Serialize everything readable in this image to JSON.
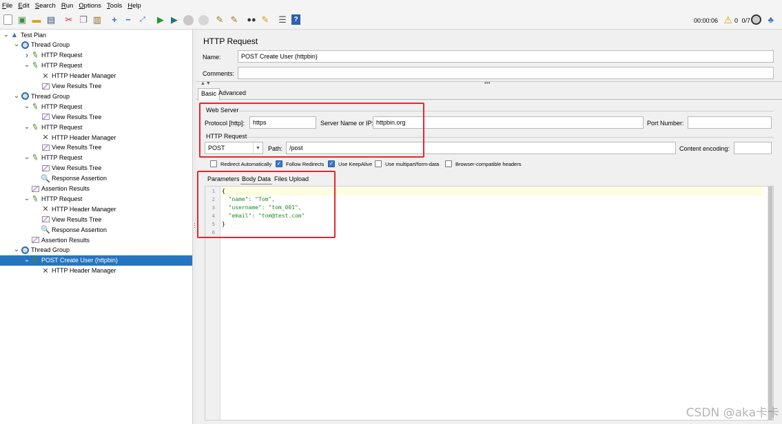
{
  "menubar": {
    "items": [
      "File",
      "Edit",
      "Search",
      "Run",
      "Options",
      "Tools",
      "Help"
    ]
  },
  "toolbar": {
    "icons": [
      "new-icon",
      "templates-icon",
      "open-icon",
      "save-icon",
      "cut-icon",
      "copy-icon",
      "paste-icon",
      "expand-icon",
      "collapse-icon",
      "toggle-icon",
      "start-icon",
      "start-no-pauses-icon",
      "stop-icon",
      "shutdown-icon",
      "clear-icon",
      "clear-all-icon",
      "search-icon",
      "reset-search-icon",
      "function-helper-icon",
      "help-icon"
    ],
    "elapsed_time": "00:00:06",
    "warning_count": "0",
    "thread_count": "0/7",
    "accent_color": "#2675bf"
  },
  "tree": {
    "nodes": [
      {
        "label": "Test Plan",
        "icon": "test-plan-icon",
        "arrow": "v",
        "indent": 0
      },
      {
        "label": "Thread Group",
        "icon": "thread-group-icon",
        "arrow": "v",
        "indent": 1
      },
      {
        "label": "HTTP Request",
        "icon": "sampler-icon",
        "arrow": ">",
        "indent": 2
      },
      {
        "label": "HTTP Request",
        "icon": "sampler-icon",
        "arrow": "v",
        "indent": 2
      },
      {
        "label": "HTTP Header Manager",
        "icon": "header-manager-icon",
        "arrow": "",
        "indent": 3
      },
      {
        "label": "View Results Tree",
        "icon": "listener-icon",
        "arrow": "",
        "indent": 3
      },
      {
        "label": "Thread Group",
        "icon": "thread-group-icon",
        "arrow": "v",
        "indent": 1
      },
      {
        "label": "HTTP Request",
        "icon": "sampler-icon",
        "arrow": "v",
        "indent": 2
      },
      {
        "label": "View Results Tree",
        "icon": "listener-icon",
        "arrow": "",
        "indent": 3
      },
      {
        "label": "HTTP Request",
        "icon": "sampler-icon",
        "arrow": "v",
        "indent": 2
      },
      {
        "label": "HTTP Header Manager",
        "icon": "header-manager-icon",
        "arrow": "",
        "indent": 3
      },
      {
        "label": "View Results Tree",
        "icon": "listener-icon",
        "arrow": "",
        "indent": 3
      },
      {
        "label": "HTTP Request",
        "icon": "sampler-icon",
        "arrow": "v",
        "indent": 2
      },
      {
        "label": "View Results Tree",
        "icon": "listener-icon",
        "arrow": "",
        "indent": 3
      },
      {
        "label": "Response Assertion",
        "icon": "assertion-icon",
        "arrow": "",
        "indent": 3
      },
      {
        "label": "Assertion Results",
        "icon": "listener-icon",
        "arrow": "",
        "indent": 2
      },
      {
        "label": "HTTP Request",
        "icon": "sampler-icon",
        "arrow": "v",
        "indent": 2
      },
      {
        "label": "HTTP Header Manager",
        "icon": "header-manager-icon",
        "arrow": "",
        "indent": 3
      },
      {
        "label": "View Results Tree",
        "icon": "listener-icon",
        "arrow": "",
        "indent": 3
      },
      {
        "label": "Response Assertion",
        "icon": "assertion-icon",
        "arrow": "",
        "indent": 3
      },
      {
        "label": "Assertion Results",
        "icon": "listener-icon",
        "arrow": "",
        "indent": 2
      },
      {
        "label": "Thread Group",
        "icon": "thread-group-icon",
        "arrow": "v",
        "indent": 1
      },
      {
        "label": "POST Create User (httpbin)",
        "icon": "sampler-icon",
        "arrow": "v",
        "indent": 2,
        "selected": true
      },
      {
        "label": "HTTP Header Manager",
        "icon": "header-manager-icon",
        "arrow": "",
        "indent": 3
      }
    ]
  },
  "panel": {
    "title": "HTTP Request",
    "name_label": "Name:",
    "name_value": "POST Create User (httpbin)",
    "comments_label": "Comments:",
    "comments_value": "",
    "tabs": [
      "Basic",
      "Advanced"
    ],
    "web_server": {
      "title": "Web Server",
      "protocol_label": "Protocol [http]:",
      "protocol_value": "https",
      "server_label": "Server Name or IP:",
      "server_value": "httpbin.org",
      "port_label": "Port Number:",
      "port_value": ""
    },
    "http_request": {
      "title": "HTTP Request",
      "method": "POST",
      "path_label": "Path:",
      "path_value": "/post",
      "encoding_label": "Content encoding:",
      "encoding_value": ""
    },
    "options": [
      {
        "label": "Redirect Automatically",
        "checked": false
      },
      {
        "label": "Follow Redirects",
        "checked": true
      },
      {
        "label": "Use KeepAlive",
        "checked": true
      },
      {
        "label": "Use multipart/form-data",
        "checked": false
      },
      {
        "label": "Browser-compatible headers",
        "checked": false
      }
    ],
    "body_tabs": [
      "Parameters",
      "Body Data",
      "Files Upload"
    ],
    "body_lines": [
      "{",
      "  \"name\": \"Tom\",",
      "  \"username\": \"tom_001\",",
      "  \"email\": \"tom@test.com\"",
      "}",
      ""
    ],
    "line_numbers": [
      "1",
      "2",
      "3",
      "4",
      "5",
      "6"
    ]
  },
  "highlight_color": "#e5262e",
  "watermark": "CSDN @aka卡卡"
}
